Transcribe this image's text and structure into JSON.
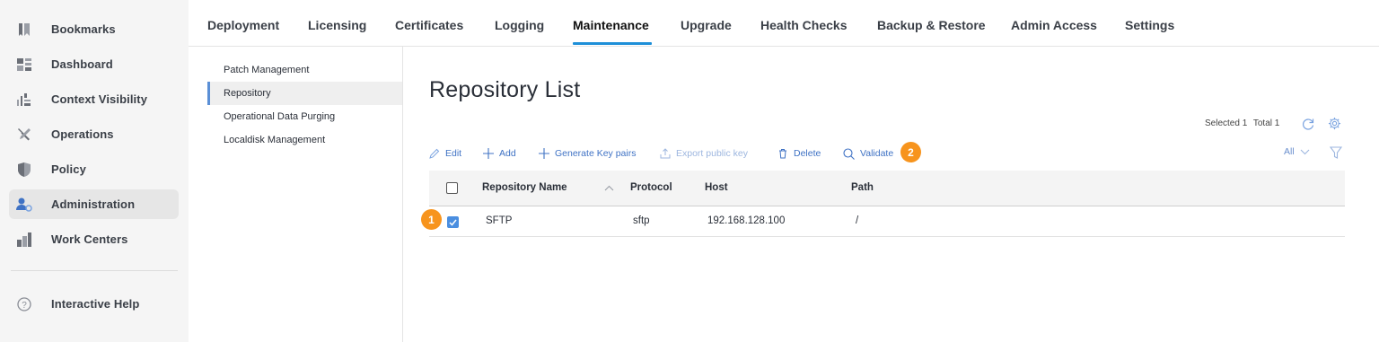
{
  "sidebar": {
    "items": [
      {
        "label": "Bookmarks",
        "icon": "bookmark-icon"
      },
      {
        "label": "Dashboard",
        "icon": "dashboard-icon"
      },
      {
        "label": "Context Visibility",
        "icon": "context-visibility-icon"
      },
      {
        "label": "Operations",
        "icon": "tools-icon"
      },
      {
        "label": "Policy",
        "icon": "shield-icon"
      },
      {
        "label": "Administration",
        "icon": "admin-user-icon",
        "active": true
      },
      {
        "label": "Work Centers",
        "icon": "work-centers-icon"
      }
    ],
    "help_label": "Interactive Help"
  },
  "tabs": [
    {
      "label": "Deployment"
    },
    {
      "label": "Licensing"
    },
    {
      "label": "Certificates"
    },
    {
      "label": "Logging"
    },
    {
      "label": "Maintenance",
      "active": true
    },
    {
      "label": "Upgrade"
    },
    {
      "label": "Health Checks"
    },
    {
      "label": "Backup & Restore"
    },
    {
      "label": "Admin Access"
    },
    {
      "label": "Settings"
    }
  ],
  "subnav": [
    {
      "label": "Patch Management"
    },
    {
      "label": "Repository",
      "active": true
    },
    {
      "label": "Operational Data Purging"
    },
    {
      "label": "Localdisk Management"
    }
  ],
  "page": {
    "title": "Repository List",
    "selected_label": "Selected 1",
    "total_label": "Total 1"
  },
  "toolbar": {
    "edit": "Edit",
    "add": "Add",
    "generate": "Generate Key pairs",
    "export": "Export public key",
    "delete": "Delete",
    "validate": "Validate",
    "filter": "All"
  },
  "badges": {
    "one": "1",
    "two": "2"
  },
  "table": {
    "headers": [
      "Repository Name",
      "Protocol",
      "Host",
      "Path"
    ],
    "rows": [
      {
        "name": "SFTP",
        "protocol": "sftp",
        "host": "192.168.128.100",
        "path": "/",
        "checked": true
      }
    ]
  },
  "colors": {
    "accent": "#1d8fd8",
    "link": "#3f72c4",
    "badge": "#f7941d",
    "checkbox": "#4a8ee0"
  }
}
